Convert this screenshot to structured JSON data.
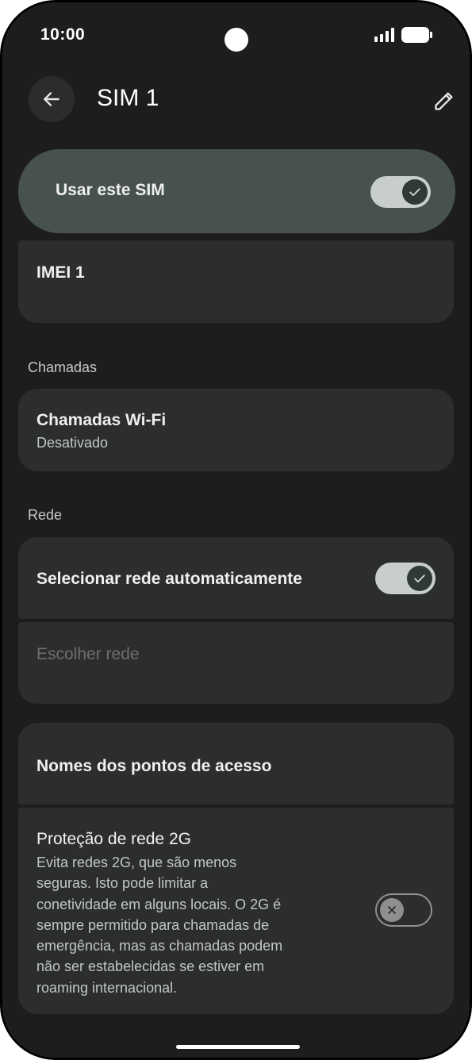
{
  "status_bar": {
    "time": "10:00"
  },
  "header": {
    "title": "SIM 1",
    "back_icon": "arrow-back-icon",
    "edit_icon": "pencil-icon"
  },
  "use_sim": {
    "label": "Usar este SIM",
    "enabled": true
  },
  "imei": {
    "label": "IMEI 1"
  },
  "calls_section": {
    "header": "Chamadas",
    "wifi_calling": {
      "title": "Chamadas Wi-Fi",
      "status": "Desativado"
    }
  },
  "network_section": {
    "header": "Rede",
    "auto_select": {
      "label": "Selecionar rede automaticamente",
      "enabled": true
    },
    "choose_network": {
      "label": "Escolher rede"
    }
  },
  "apn": {
    "label": "Nomes dos pontos de acesso"
  },
  "protection_2g": {
    "title": "Proteção de rede 2G",
    "description_lines": [
      "Evita redes 2G, que são menos",
      "seguras. Isto pode limitar a",
      "conetividade em alguns locais. O 2G é",
      "sempre permitido para chamadas de",
      "emergência, mas as chamadas podem",
      "não ser estabelecidas se estiver em",
      "roaming internacional."
    ],
    "enabled": false
  },
  "colors": {
    "background": "#1c1d1c",
    "card": "#2c2e2d",
    "hero": "#47514d",
    "toggle_on_track": "#c8cfcb",
    "toggle_on_knob": "#2f3a36"
  }
}
